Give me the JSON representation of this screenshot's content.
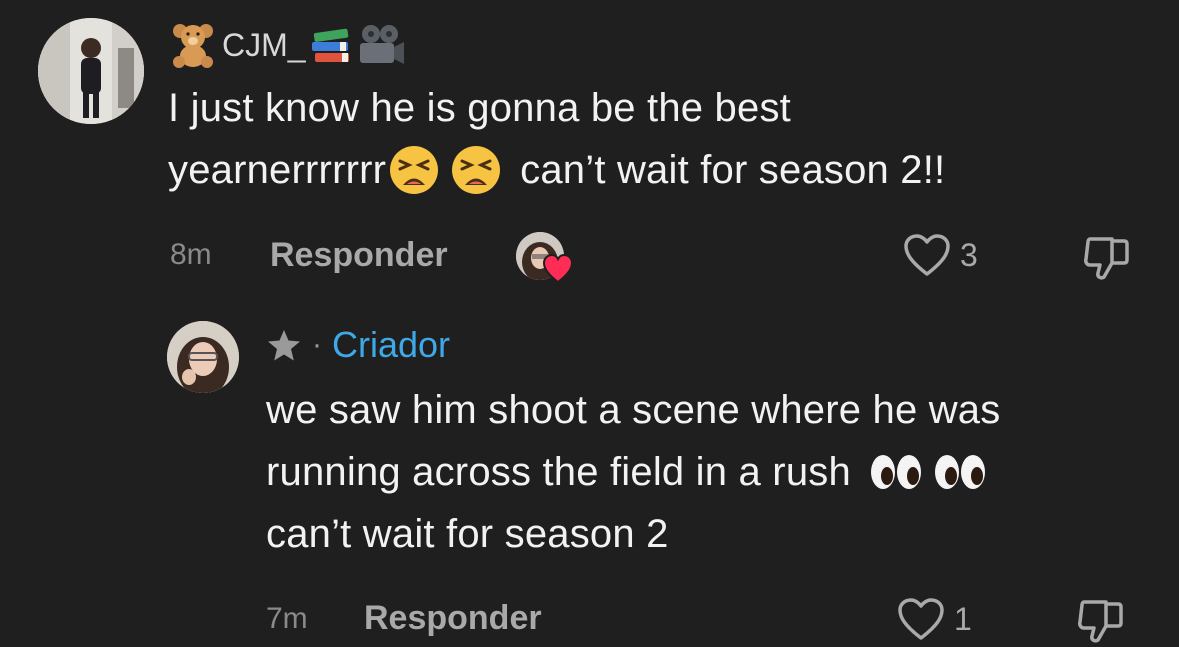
{
  "comment": {
    "username_prefix_icon": "teddy-bear-icon",
    "username": "CJM_",
    "username_suffix_icons": [
      "books-icon",
      "film-camera-icon"
    ],
    "text_line1": "I just know he is gonna be the best",
    "text_line2_a": "yearnerrrrrrr",
    "text_line2_emojis": [
      "tired-face-icon",
      "tired-face-icon"
    ],
    "text_line2_b": "can’t wait for season 2!!",
    "time": "8m",
    "reply_label": "Responder",
    "like_count": "3"
  },
  "reply": {
    "badge_icon": "star-icon",
    "separator": "·",
    "author_label": "Criador",
    "text_line1": "we saw him shoot a scene where he was",
    "text_line2": "running across the field in a rush",
    "text_line2_emojis": [
      "eyes-icon",
      "eyes-icon"
    ],
    "text_line3": "can’t wait for season 2",
    "time": "7m",
    "reply_label": "Responder",
    "like_count": "1"
  },
  "colors": {
    "background": "#1f1f1f",
    "creator_accent": "#3fa9e8",
    "heart_red": "#ff2d55",
    "muted_text": "#a9a9a9"
  }
}
